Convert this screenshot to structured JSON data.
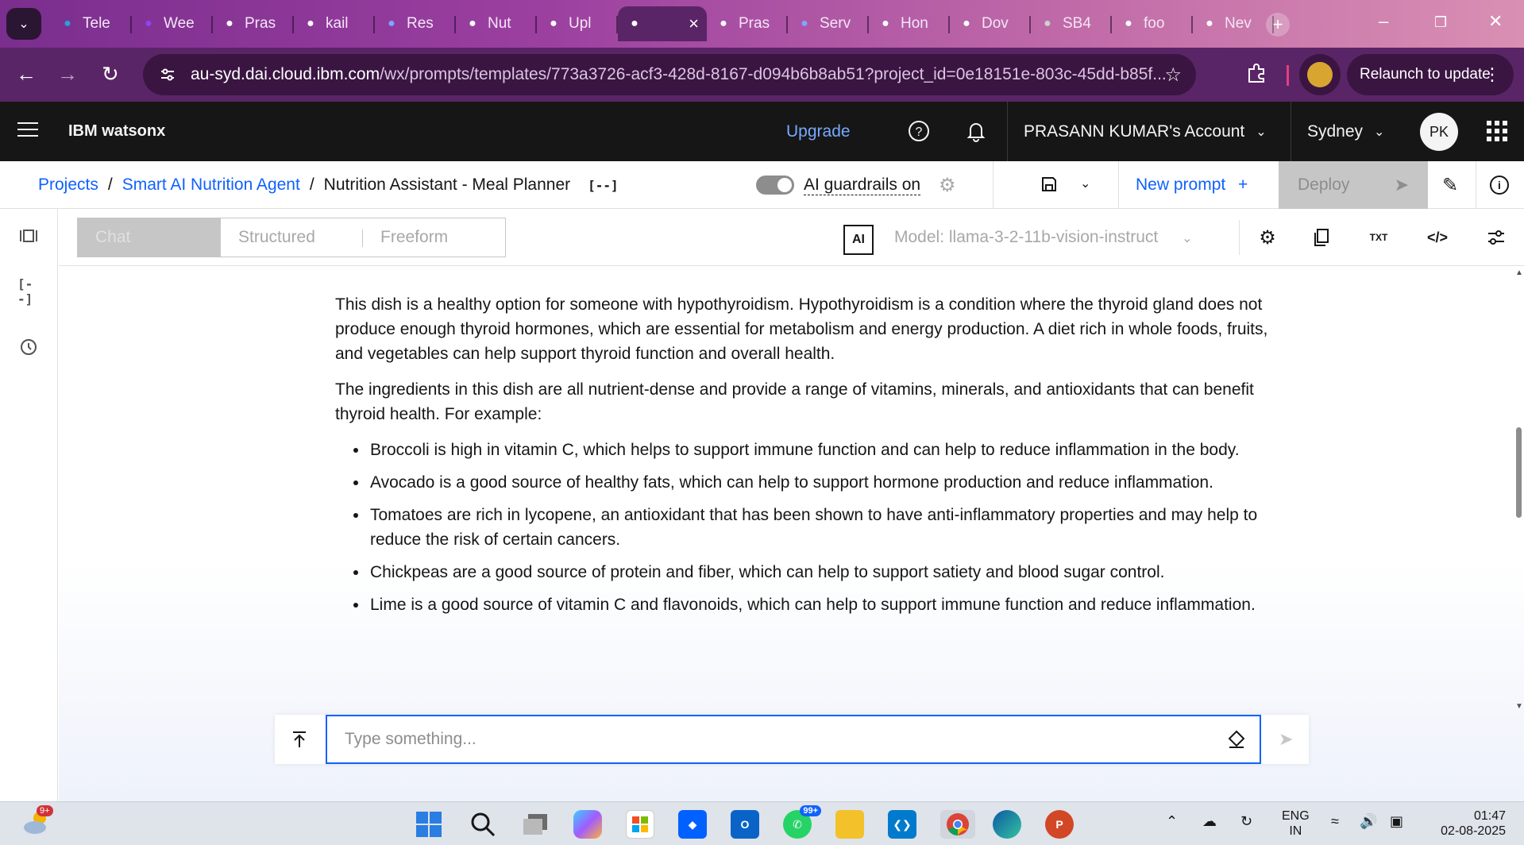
{
  "browser": {
    "tabs": [
      {
        "label": "Tele",
        "icon": "telegram-icon",
        "color": "#2aa1da"
      },
      {
        "label": "Wee",
        "icon": "video-icon",
        "color": "#8e44ef"
      },
      {
        "label": "Pras",
        "icon": "github-icon",
        "color": "#ffffff"
      },
      {
        "label": "kail",
        "icon": "github-icon",
        "color": "#ffffff"
      },
      {
        "label": "Res",
        "icon": "watsonx-icon",
        "color": "#7aa7ff"
      },
      {
        "label": "Nut",
        "icon": "openai-icon",
        "color": "#ffffff"
      },
      {
        "label": "Upl",
        "icon": "openai-icon",
        "color": "#ffffff"
      },
      {
        "label": "",
        "icon": "openai-icon",
        "color": "#ffffff",
        "active": true
      },
      {
        "label": "Pras",
        "icon": "github-icon",
        "color": "#ffffff"
      },
      {
        "label": "Serv",
        "icon": "watsonx-icon",
        "color": "#7aa7ff"
      },
      {
        "label": "Hon",
        "icon": "openai-icon",
        "color": "#ffffff"
      },
      {
        "label": "Dov",
        "icon": "download-icon",
        "color": "#ffffff"
      },
      {
        "label": "SB4",
        "icon": "globe-icon",
        "color": "#cfcfcf"
      },
      {
        "label": "foo",
        "icon": "google-icon",
        "color": "#ffffff"
      },
      {
        "label": "Nev",
        "icon": "chrome-icon",
        "color": "#ffffff"
      }
    ],
    "url_main": "au-syd.dai.cloud.ibm.com",
    "url_rest": "/wx/prompts/templates/773a3726-acf3-428d-8167-d094b6b8ab51?project_id=0e18151e-803c-45dd-b85f...",
    "relaunch_label": "Relaunch to update"
  },
  "header": {
    "brand": "IBM watsonx",
    "upgrade": "Upgrade",
    "account": "PRASANN KUMAR's Account",
    "region": "Sydney",
    "avatar_initials": "PK"
  },
  "breadcrumb": {
    "items": [
      "Projects",
      "Smart AI Nutrition Agent"
    ],
    "current": "Nutrition Assistant - Meal Planner",
    "var_icon": "[--]",
    "guardrails_label": "AI guardrails on",
    "new_prompt": "New prompt",
    "deploy": "Deploy"
  },
  "toolbar": {
    "modes": [
      "Chat",
      "Structured",
      "Freeform"
    ],
    "active_mode": "Chat",
    "ai_badge": "AI",
    "model_label": "Model: llama-3-2-11b-vision-instruct",
    "txt_label": "TXT"
  },
  "rail": {
    "var_label": "[--]"
  },
  "content": {
    "para1": "This dish is a healthy option for someone with hypothyroidism. Hypothyroidism is a condition where the thyroid gland does not produce enough thyroid hormones, which are essential for metabolism and energy production. A diet rich in whole foods, fruits, and vegetables can help support thyroid function and overall health.",
    "para2": "The ingredients in this dish are all nutrient-dense and provide a range of vitamins, minerals, and antioxidants that can benefit thyroid health. For example:",
    "bullets": [
      "Broccoli is high in vitamin C, which helps to support immune function and can help to reduce inflammation in the body.",
      "Avocado is a good source of healthy fats, which can help to support hormone production and reduce inflammation.",
      "Tomatoes are rich in lycopene, an antioxidant that has been shown to have anti-inflammatory properties and may help to reduce the risk of certain cancers.",
      "Chickpeas are a good source of protein and fiber, which can help to support satiety and blood sugar control.",
      "Lime is a good source of vitamin C and flavonoids, which can help to support immune function and reduce inflammation."
    ],
    "scroll_position": 0.45
  },
  "input": {
    "placeholder": "Type something...",
    "value": ""
  },
  "taskbar": {
    "weather_badge": "9+",
    "whatsapp_badge": "99+",
    "lang_line1": "ENG",
    "lang_line2": "IN",
    "time": "01:47",
    "date": "02-08-2025"
  },
  "colors": {
    "accent": "#0f62fe",
    "header_bg": "#161616",
    "browser_frame": "#5a2566"
  }
}
